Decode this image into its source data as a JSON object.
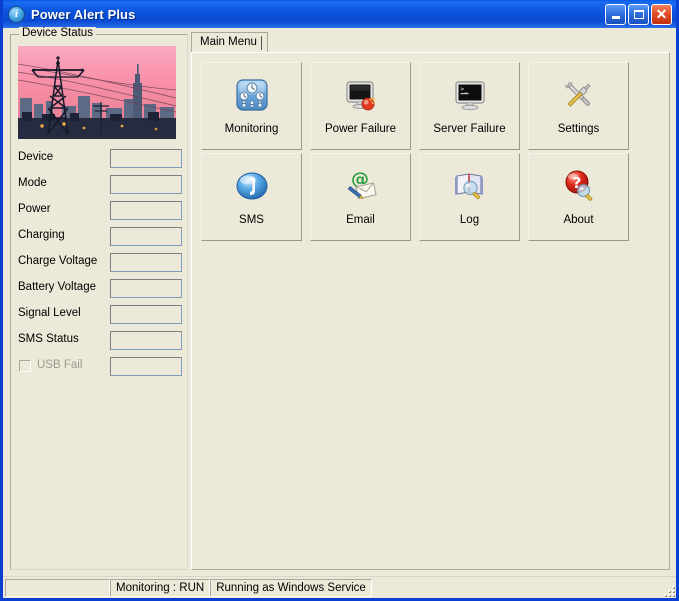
{
  "window": {
    "title": "Power Alert Plus",
    "icon": "info-icon",
    "controls": {
      "minimize": "minimize-button",
      "maximize": "maximize-button",
      "close": "close-button",
      "close_glyph": "✕"
    },
    "accent_color": "#0a3fd4",
    "face_color": "#ece9d8"
  },
  "device_status": {
    "legend": "Device Status",
    "image_alt": "power-transmission-tower-city-skyline-sunset",
    "fields": [
      {
        "label": "Device",
        "value": ""
      },
      {
        "label": "Mode",
        "value": ""
      },
      {
        "label": "Power",
        "value": ""
      },
      {
        "label": "Charging",
        "value": ""
      },
      {
        "label": "Charge Voltage",
        "value": ""
      },
      {
        "label": "Battery Voltage",
        "value": ""
      },
      {
        "label": "Signal Level",
        "value": ""
      },
      {
        "label": "SMS Status",
        "value": ""
      }
    ],
    "usb_fail": {
      "label": "USB Fail",
      "checked": false,
      "enabled": false,
      "value": ""
    }
  },
  "tabs": [
    {
      "label": "Main Menu",
      "selected": true
    }
  ],
  "main_menu": {
    "buttons": [
      {
        "label": "Monitoring",
        "icon": "monitoring-gauges-icon"
      },
      {
        "label": "Power Failure",
        "icon": "monitor-power-failure-icon"
      },
      {
        "label": "Server Failure",
        "icon": "server-console-failure-icon"
      },
      {
        "label": "Settings",
        "icon": "wrench-screwdriver-icon"
      },
      {
        "label": "SMS",
        "icon": "phone-handset-sphere-icon"
      },
      {
        "label": "Email",
        "icon": "at-envelope-icon"
      },
      {
        "label": "Log",
        "icon": "book-magnifier-icon"
      },
      {
        "label": "About",
        "icon": "question-mark-magnifier-icon"
      }
    ]
  },
  "statusbar": {
    "panels": [
      {
        "text": ""
      },
      {
        "text": "Monitoring : RUN"
      },
      {
        "text": "Running as Windows Service"
      }
    ],
    "grip": "resize-grip"
  }
}
